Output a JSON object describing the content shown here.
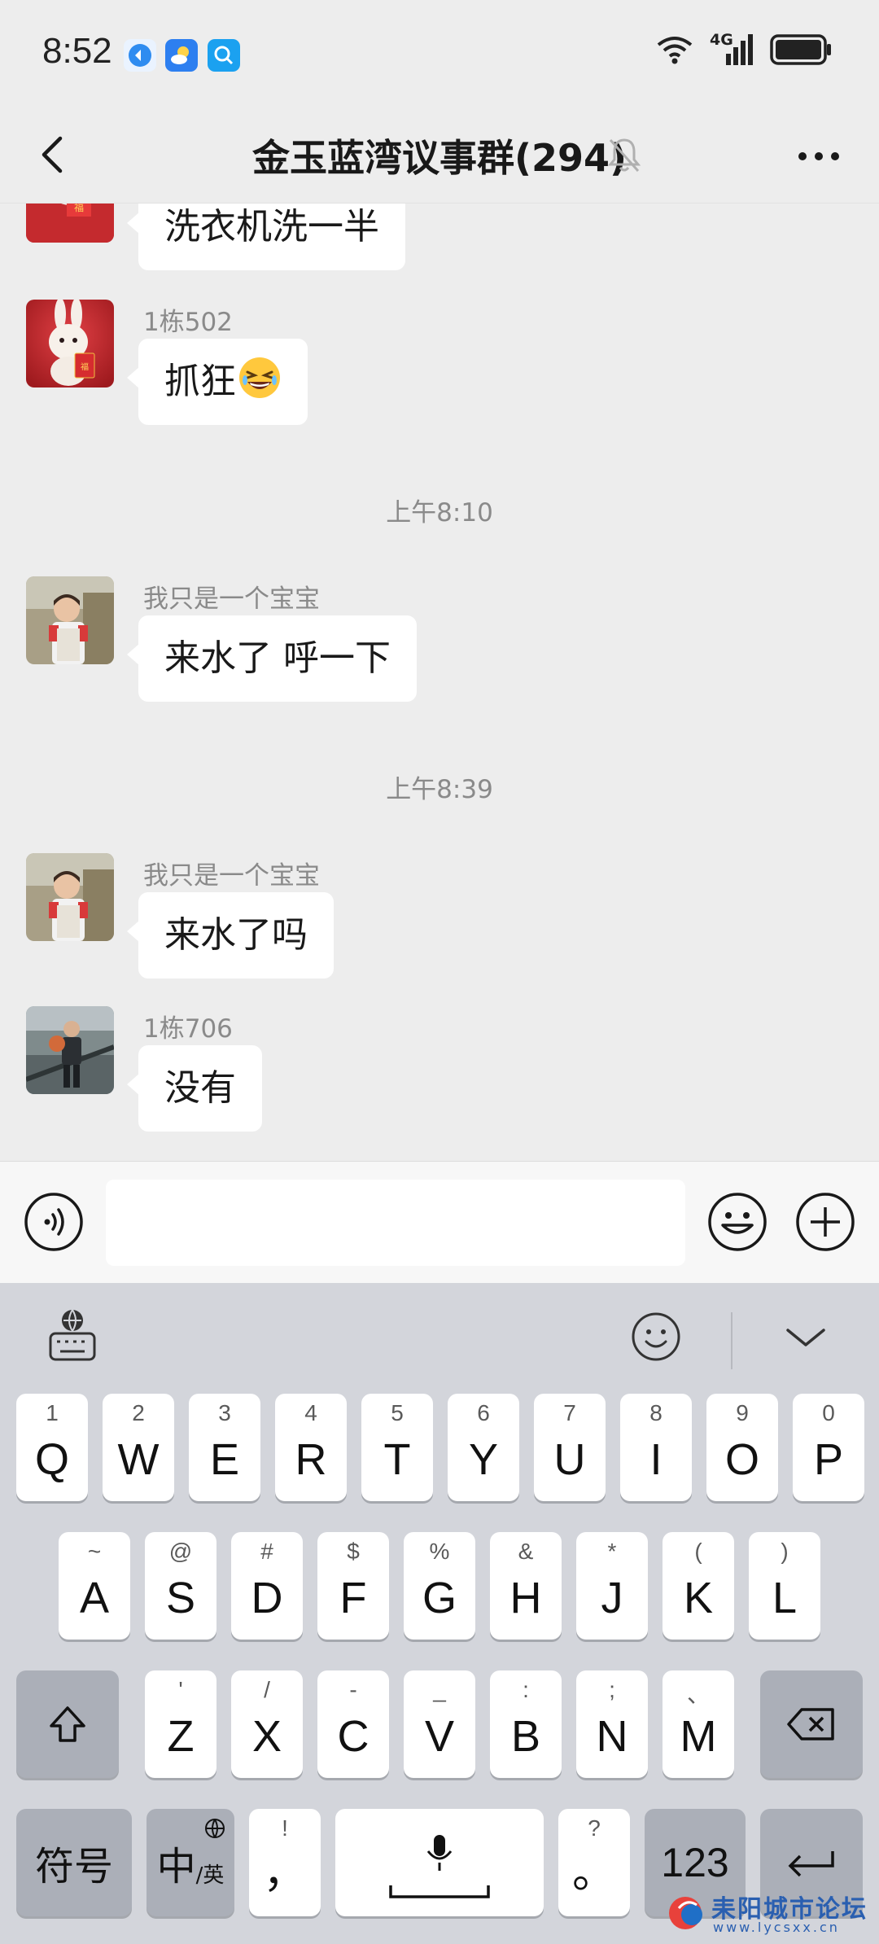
{
  "status_bar": {
    "time": "8:52",
    "network": "4G"
  },
  "header": {
    "title": "金玉蓝湾议事群(294)"
  },
  "messages": [
    {
      "type": "message",
      "sender": "",
      "text": "洗衣机洗一半"
    },
    {
      "type": "message",
      "sender": "1栋502",
      "text": "抓狂",
      "emoji": "grinning-squinting-face"
    },
    {
      "type": "time",
      "text": "上午8:10"
    },
    {
      "type": "message",
      "sender": "我只是一个宝宝",
      "text": "来水了 呼一下"
    },
    {
      "type": "time",
      "text": "上午8:39"
    },
    {
      "type": "message",
      "sender": "我只是一个宝宝",
      "text": "来水了吗"
    },
    {
      "type": "message",
      "sender": "1栋706",
      "text": "没有"
    }
  ],
  "input": {
    "value": "",
    "placeholder": ""
  },
  "keyboard": {
    "row1": [
      {
        "main": "Q",
        "sub": "1"
      },
      {
        "main": "W",
        "sub": "2"
      },
      {
        "main": "E",
        "sub": "3"
      },
      {
        "main": "R",
        "sub": "4"
      },
      {
        "main": "T",
        "sub": "5"
      },
      {
        "main": "Y",
        "sub": "6"
      },
      {
        "main": "U",
        "sub": "7"
      },
      {
        "main": "I",
        "sub": "8"
      },
      {
        "main": "O",
        "sub": "9"
      },
      {
        "main": "P",
        "sub": "0"
      }
    ],
    "row2": [
      {
        "main": "A",
        "sub": "~"
      },
      {
        "main": "S",
        "sub": "@"
      },
      {
        "main": "D",
        "sub": "#"
      },
      {
        "main": "F",
        "sub": "$"
      },
      {
        "main": "G",
        "sub": "%"
      },
      {
        "main": "H",
        "sub": "&"
      },
      {
        "main": "J",
        "sub": "*"
      },
      {
        "main": "K",
        "sub": "("
      },
      {
        "main": "L",
        "sub": ")"
      }
    ],
    "row3": [
      {
        "main": "Z",
        "sub": "'"
      },
      {
        "main": "X",
        "sub": "/"
      },
      {
        "main": "C",
        "sub": "-"
      },
      {
        "main": "V",
        "sub": "_"
      },
      {
        "main": "B",
        "sub": ":"
      },
      {
        "main": "N",
        "sub": ";"
      },
      {
        "main": "M",
        "sub": "、"
      }
    ],
    "symbols_label": "符号",
    "lang_main": "中",
    "lang_sub": "/英",
    "comma_main": "，",
    "comma_sub": "!",
    "period_main": "。",
    "period_sub": "?",
    "numbers_label": "123"
  },
  "watermark": {
    "brand": "耒阳城市论坛",
    "url": "www.lycsxx.cn"
  }
}
